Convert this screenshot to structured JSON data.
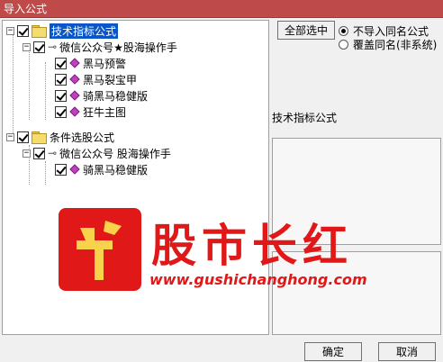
{
  "window": {
    "title": "导入公式"
  },
  "tree": {
    "groups": [
      {
        "label": "技术指标公式",
        "selected": true,
        "author": {
          "label": "微信公众号★股海操作手",
          "items": [
            "黑马预警",
            "黑马裂宝甲",
            "骑黑马稳健版",
            "狂牛主图"
          ]
        }
      },
      {
        "label": "条件选股公式",
        "selected": false,
        "author": {
          "label": "微信公众号 股海操作手",
          "items": [
            "骑黑马稳健版"
          ]
        }
      }
    ]
  },
  "options": {
    "select_all_label": "全部选中",
    "radio_no_import_label": "不导入同名公式",
    "radio_overwrite_label": "覆盖同名(非系统)",
    "selected_radio": "no_import"
  },
  "detail": {
    "formula_name": "技术指标公式"
  },
  "watermark": {
    "logo_char": "牛",
    "brand_text": "股市长红",
    "url": "www.gushichanghong.com",
    "color": "#e01818"
  },
  "footer": {
    "ok_label": "确定",
    "cancel_label": "取消"
  },
  "colors": {
    "titlebar": "#bf4a4a",
    "selection": "#0a56c6"
  }
}
